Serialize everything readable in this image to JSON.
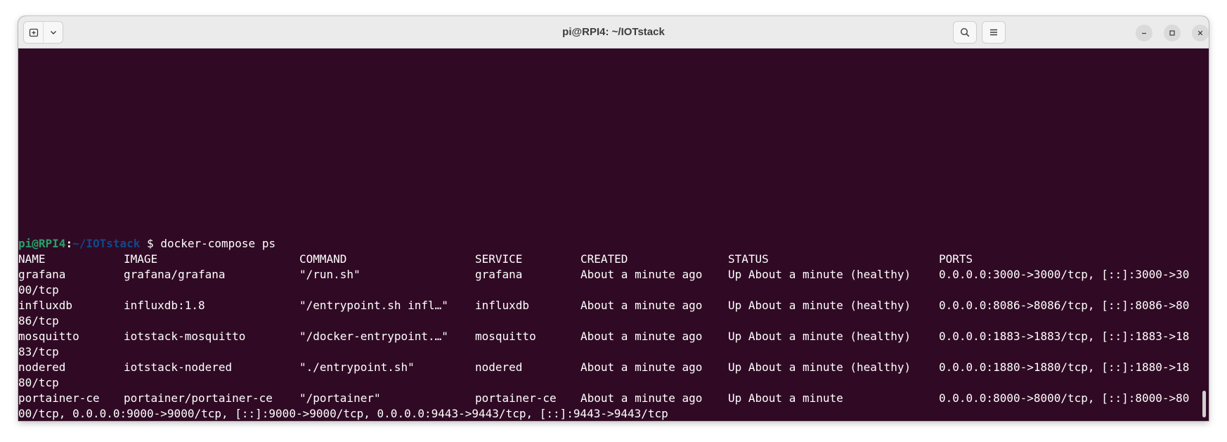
{
  "window": {
    "title": "pi@RPI4: ~/IOTstack"
  },
  "icons": {
    "new_tab": "new-tab-icon",
    "tab_menu": "chevron-down-icon",
    "search": "search-icon",
    "menu": "hamburger-menu-icon",
    "minimize": "minimize-icon",
    "maximize": "maximize-icon",
    "close": "close-icon"
  },
  "colors": {
    "terminal_bg": "#300a24",
    "prompt_user": "#26a269",
    "prompt_path": "#12488b",
    "text": "#ffffff"
  },
  "prompt": {
    "user_host": "pi@RPI4",
    "colon": ":",
    "path": "~/IOTstack",
    "dollar": "$"
  },
  "command": "docker-compose ps",
  "table": {
    "headers": [
      "NAME",
      "IMAGE",
      "COMMAND",
      "SERVICE",
      "CREATED",
      "STATUS",
      "PORTS"
    ],
    "rows": [
      {
        "name": "grafana",
        "image": "grafana/grafana",
        "command": "\"/run.sh\"",
        "service": "grafana",
        "created": "About a minute ago",
        "status": "Up About a minute (healthy)",
        "ports": "0.0.0.0:3000->3000/tcp, [::]:3000->30",
        "ports_wrap": "00/tcp"
      },
      {
        "name": "influxdb",
        "image": "influxdb:1.8",
        "command": "\"/entrypoint.sh infl…\"",
        "service": "influxdb",
        "created": "About a minute ago",
        "status": "Up About a minute (healthy)",
        "ports": "0.0.0.0:8086->8086/tcp, [::]:8086->80",
        "ports_wrap": "86/tcp"
      },
      {
        "name": "mosquitto",
        "image": "iotstack-mosquitto",
        "command": "\"/docker-entrypoint.…\"",
        "service": "mosquitto",
        "created": "About a minute ago",
        "status": "Up About a minute (healthy)",
        "ports": "0.0.0.0:1883->1883/tcp, [::]:1883->18",
        "ports_wrap": "83/tcp"
      },
      {
        "name": "nodered",
        "image": "iotstack-nodered",
        "command": "\"./entrypoint.sh\"",
        "service": "nodered",
        "created": "About a minute ago",
        "status": "Up About a minute (healthy)",
        "ports": "0.0.0.0:1880->1880/tcp, [::]:1880->18",
        "ports_wrap": "80/tcp"
      },
      {
        "name": "portainer-ce",
        "image": "portainer/portainer-ce",
        "command": "\"/portainer\"",
        "service": "portainer-ce",
        "created": "About a minute ago",
        "status": "Up About a minute",
        "ports": "0.0.0.0:8000->8000/tcp, [::]:8000->80",
        "ports_wrap": "00/tcp, 0.0.0.0:9000->9000/tcp, [::]:9000->9000/tcp, 0.0.0.0:9443->9443/tcp, [::]:9443->9443/tcp"
      }
    ]
  }
}
